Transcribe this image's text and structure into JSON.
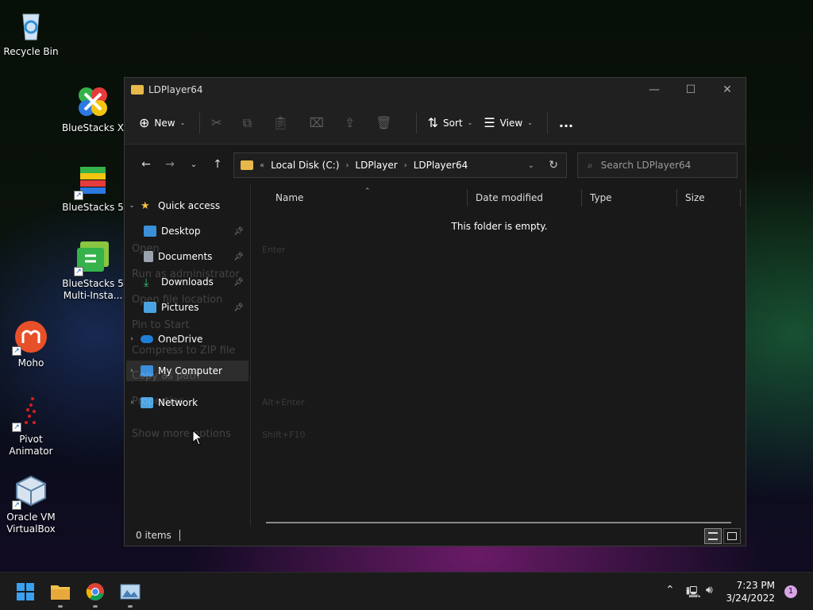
{
  "desktop": {
    "icons": [
      {
        "label": "Recycle Bin",
        "icon": "recycle-bin-icon"
      },
      {
        "label": "BlueStacks X",
        "icon": "bluestacks-x-icon"
      },
      {
        "label": "BlueStacks 5",
        "icon": "bluestacks-5-icon"
      },
      {
        "label": "BlueStacks 5 Multi-Insta...",
        "icon": "bluestacks-multi-instance-icon"
      },
      {
        "label": "Moho",
        "icon": "moho-icon"
      },
      {
        "label": "Pivot Animator",
        "icon": "pivot-animator-icon"
      },
      {
        "label": "Oracle VM VirtualBox",
        "icon": "virtualbox-icon"
      }
    ]
  },
  "window": {
    "title": "LDPlayer64",
    "command_bar": {
      "new_label": "New",
      "sort_label": "Sort",
      "view_label": "View",
      "more_label": "..."
    },
    "address": {
      "crumbs": [
        "Local Disk (C:)",
        "LDPlayer",
        "LDPlayer64"
      ],
      "overflow": "«"
    },
    "search": {
      "placeholder": "Search LDPlayer64"
    },
    "nav_pane": {
      "quick_access": "Quick access",
      "items": [
        {
          "label": "Desktop",
          "pinned": true
        },
        {
          "label": "Documents",
          "pinned": true
        },
        {
          "label": "Downloads",
          "pinned": true
        },
        {
          "label": "Pictures",
          "pinned": true
        }
      ],
      "onedrive": "OneDrive",
      "my_computer": "My Computer",
      "network": "Network"
    },
    "columns": [
      "Name",
      "Date modified",
      "Type",
      "Size"
    ],
    "empty_message": "This folder is empty.",
    "status": {
      "items": "0 items"
    },
    "ghost_menu": {
      "items": [
        "Open",
        "Run as administrator",
        "Open file location",
        "Pin to Start",
        "Compress to ZIP file",
        "Copy as path",
        "Properties",
        "Show more options"
      ],
      "shortcuts": [
        "Enter",
        "Alt+Enter",
        "Shift+F10"
      ]
    }
  },
  "taskbar": {
    "time": "7:23 PM",
    "date": "3/24/2022",
    "notification_count": "1"
  },
  "colors": {
    "accent": "#0078d4",
    "folder": "#e8b84a",
    "window_bg": "#191919"
  }
}
